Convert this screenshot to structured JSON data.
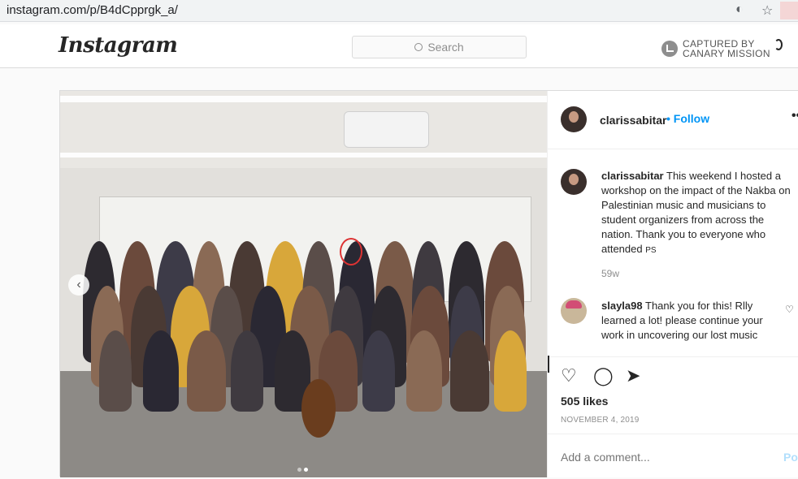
{
  "browser": {
    "url": "instagram.com/p/B4dCpprgk_a/",
    "icons": [
      "eye-off-icon",
      "star-icon"
    ]
  },
  "nav": {
    "logo": "Instagram",
    "search_placeholder": "Search",
    "canary_line1": "CAPTURED BY",
    "canary_line2": "CANARY MISSION"
  },
  "post": {
    "username": "clarissabitar",
    "follow_label": "Follow",
    "more_label": "•••",
    "caption_user": "clarissabitar",
    "caption_text": "This weekend I hosted a workshop on the impact of the Nakba on Palestinian music and musicians to student organizers from across the nation. Thank you to everyone who attended",
    "caption_badge": "PS",
    "time_ago": "59w",
    "comments": [
      {
        "user": "slayla98",
        "text": "Thank you for this! Rlly learned a lot! please continue your work in uncovering our lost music"
      }
    ],
    "likes": "505 likes",
    "date": "NOVEMBER 4, 2019",
    "add_comment_placeholder": "Add a comment...",
    "post_button": "Post",
    "carousel": {
      "count": 2,
      "active": 2
    }
  },
  "colors": {
    "accent": "#0095f6",
    "annotation_circle": "#dd3333"
  }
}
